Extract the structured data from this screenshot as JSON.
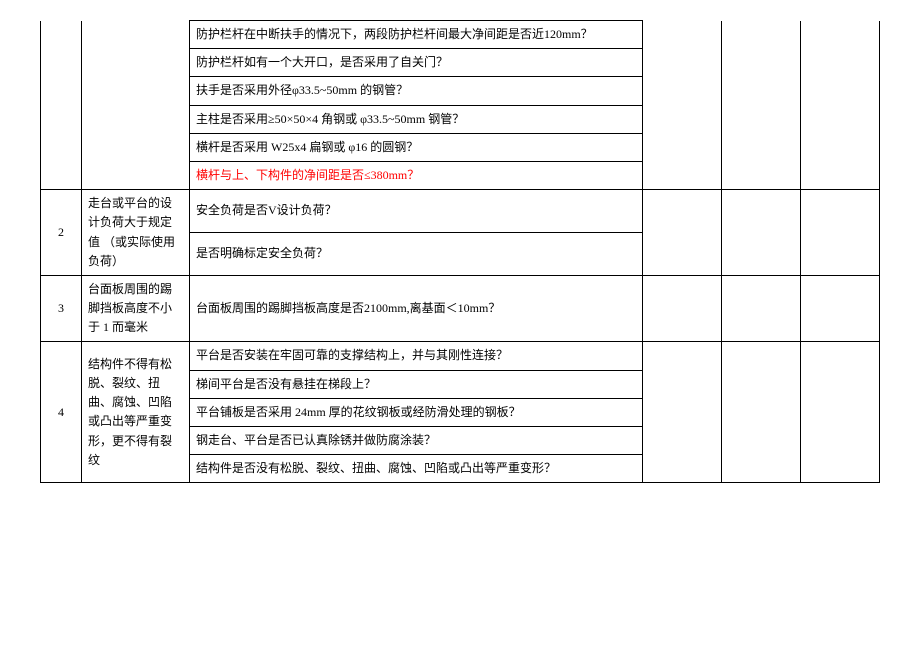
{
  "r1_q1": "防护栏杆在中断扶手的情况下，两段防护栏杆间最大净间距是否近120mm？",
  "r1_q2": "防护栏杆如有一个大开口，是否采用了自关门？",
  "r1_q3": "扶手是否采用外径φ33.5~50mm 的钢管？",
  "r1_q4": "主柱是否采用≥50×50×4 角钢或 φ33.5~50mm 钢管？",
  "r1_q5": "横杆是否采用 W25x4 扁钢或 φ16 的圆钢？",
  "r1_q6": "横杆与上、下构件的净间距是否≤380mm？",
  "n2": "2",
  "t2": "走台或平台的设计负荷大于规定值\n（或实际使用负荷）",
  "r2_q1": "安全负荷是否V设计负荷？",
  "r2_q2": "是否明确标定安全负荷？",
  "n3": "3",
  "t3": "台面板周围的踢脚挡板高度不小于 1 而毫米",
  "r3_q1": "台面板周围的踢脚挡板高度是否2100mm,离基面＜10mm？",
  "n4": "4",
  "t4": "结构件不得有松脱、裂纹、扭曲、腐蚀、凹陷或凸出等严重变形，更不得有裂纹",
  "r4_q1": "平台是否安装在牢固可靠的支撑结构上，并与其刚性连接？",
  "r4_q2": "梯间平台是否没有悬挂在梯段上？",
  "r4_q3": "平台铺板是否采用 24mm 厚的花纹钢板或经防滑处理的钢板？",
  "r4_q4": "钢走台、平台是否已认真除锈并做防腐涂装？",
  "r4_q5": "结构件是否没有松脱、裂纹、扭曲、腐蚀、凹陷或凸出等严重变形？"
}
